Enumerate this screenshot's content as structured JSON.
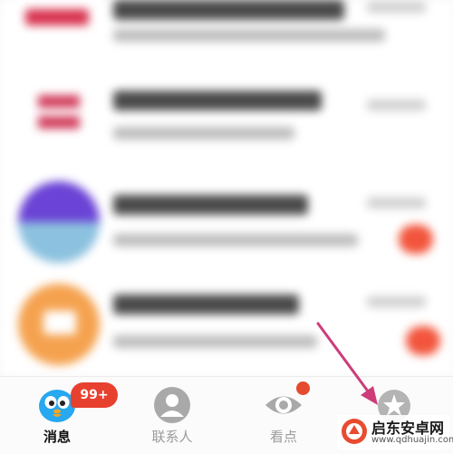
{
  "tabs": [
    {
      "label": "消息",
      "icon": "message-penguin-icon",
      "active": true
    },
    {
      "label": "联系人",
      "icon": "contacts-person-icon",
      "active": false
    },
    {
      "label": "看点",
      "icon": "eye-icon",
      "active": false
    },
    {
      "label": "",
      "icon": "star-avatar-icon",
      "active": false
    }
  ],
  "badge": {
    "count_label": "99+"
  },
  "watermark": {
    "name": "启东安卓网",
    "url": "www.qdhuajin.com"
  },
  "colors": {
    "accent_red": "#e8402f",
    "arrow_pink": "#cc3d7a",
    "active_icon_blue": "#27a8f0",
    "inactive_icon_gray": "#a9a9a9"
  }
}
